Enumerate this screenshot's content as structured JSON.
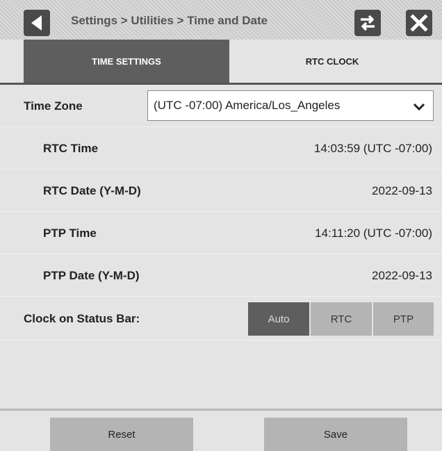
{
  "header": {
    "breadcrumb": "Settings > Utilities > Time and Date",
    "back_icon": "back-arrow-icon",
    "swap_icon": "swap-arrows-icon",
    "close_icon": "close-icon"
  },
  "tabs": [
    {
      "label": "TIME SETTINGS",
      "active": true
    },
    {
      "label": "RTC CLOCK",
      "active": false
    }
  ],
  "timezone": {
    "label": "Time Zone",
    "value": "(UTC -07:00) America/Los_Angeles"
  },
  "rows": [
    {
      "label": "RTC Time",
      "value": "14:03:59 (UTC -07:00)"
    },
    {
      "label": "RTC Date (Y-M-D)",
      "value": "2022-09-13"
    },
    {
      "label": "PTP Time",
      "value": "14:11:20 (UTC -07:00)"
    },
    {
      "label": "PTP Date (Y-M-D)",
      "value": "2022-09-13"
    }
  ],
  "status_bar_clock": {
    "label": "Clock on Status Bar:",
    "options": [
      "Auto",
      "RTC",
      "PTP"
    ],
    "selected": "Auto"
  },
  "footer": {
    "reset_label": "Reset",
    "save_label": "Save"
  },
  "colors": {
    "background": "#e4e4e4",
    "active_tab": "#5e5e5e",
    "button": "#b4b4b4"
  }
}
